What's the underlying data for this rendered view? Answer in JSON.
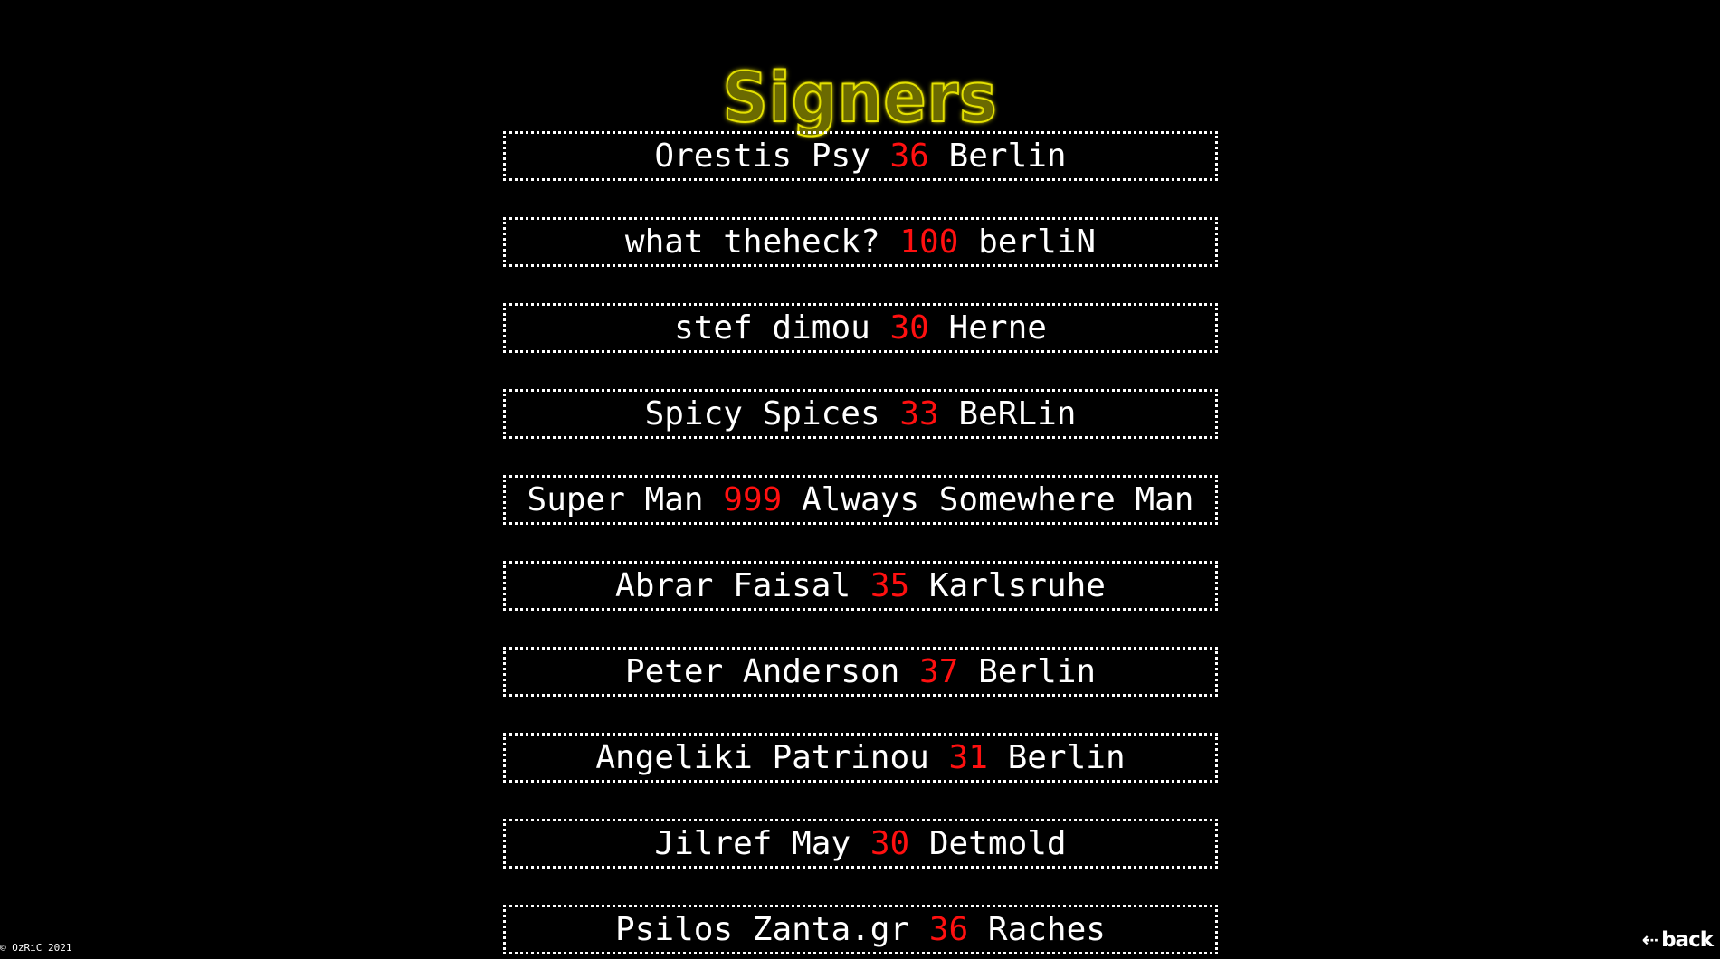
{
  "page": {
    "title": "Signers",
    "copyright": "© OzRiC 2021",
    "back_arrow": "⇠",
    "back_label": "back"
  },
  "colors": {
    "background": "#000000",
    "title_yellow": "#e4e000",
    "text": "#ffffff",
    "age_red": "#ff1010"
  },
  "signers": [
    {
      "name": "Orestis Psy",
      "age": "36",
      "city": "Berlin"
    },
    {
      "name": "what theheck?",
      "age": "100",
      "city": "berliN"
    },
    {
      "name": "stef dimou",
      "age": "30",
      "city": "Herne"
    },
    {
      "name": "Spicy Spices",
      "age": "33",
      "city": "BeRLin"
    },
    {
      "name": "Super Man",
      "age": "999",
      "city": "Always Somewhere Man"
    },
    {
      "name": "Abrar Faisal",
      "age": "35",
      "city": "Karlsruhe"
    },
    {
      "name": "Peter Anderson",
      "age": "37",
      "city": "Berlin"
    },
    {
      "name": "Angeliki Patrinou",
      "age": "31",
      "city": "Berlin"
    },
    {
      "name": "Jilref May",
      "age": "30",
      "city": "Detmold"
    },
    {
      "name": "Psilos Zanta.gr",
      "age": "36",
      "city": "Raches"
    }
  ]
}
